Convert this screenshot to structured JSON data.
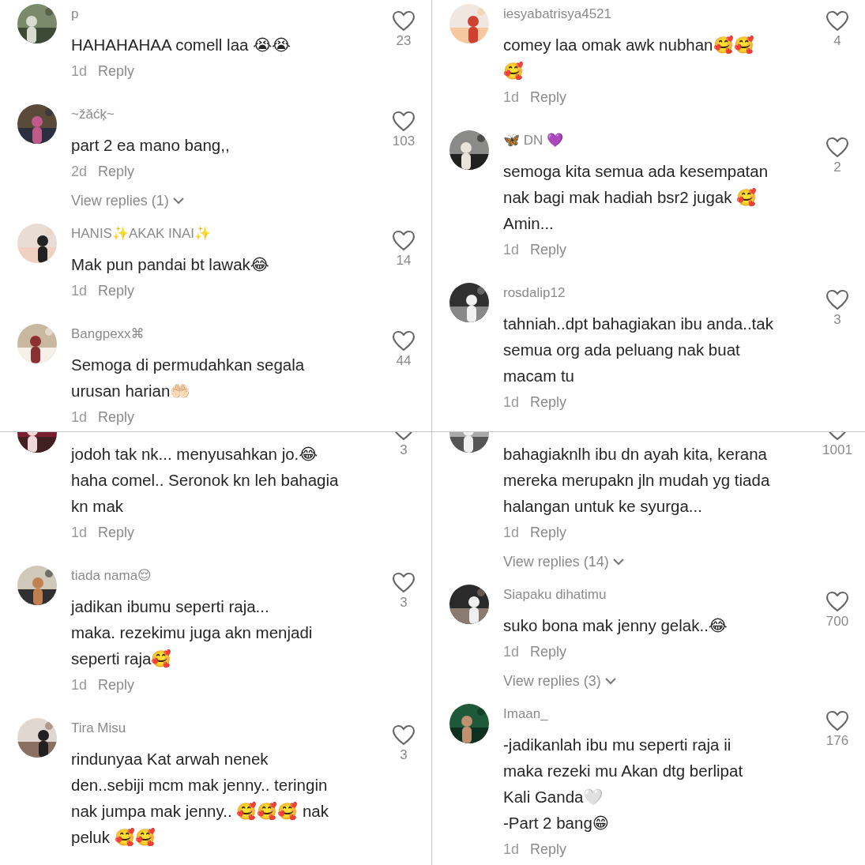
{
  "panels": [
    {
      "scrolled": false,
      "comments": [
        {
          "username": "p",
          "text": [
            "HAHAHAHAA comell laa 😭😭"
          ],
          "likes": "23",
          "age": "1d",
          "reply": "Reply"
        },
        {
          "username": "~žăćķ~",
          "text": [
            "part 2 ea mano bang,,"
          ],
          "likes": "103",
          "age": "2d",
          "reply": "Reply",
          "view_replies": "View replies (1)"
        },
        {
          "username": "HANIS✨AKAK INAI✨",
          "text": [
            "Mak pun pandai bt lawak😂"
          ],
          "likes": "14",
          "age": "1d",
          "reply": "Reply"
        },
        {
          "username": "Bangpexx⌘",
          "text": [
            "Semoga di permudahkan segala",
            "urusan harian🤲🏻"
          ],
          "likes": "44",
          "age": "1d",
          "reply": "Reply"
        }
      ]
    },
    {
      "scrolled": false,
      "comments": [
        {
          "username": "iesyabatrisya4521",
          "text": [
            "comey laa omak awk nubhan🥰🥰",
            "🥰"
          ],
          "likes": "4",
          "age": "1d",
          "reply": "Reply"
        },
        {
          "username": "🦋 DN 💜",
          "text": [
            "semoga kita semua ada kesempatan",
            "nak bagi mak hadiah bsr2 jugak 🥰",
            "Amin..."
          ],
          "likes": "2",
          "age": "1d",
          "reply": "Reply"
        },
        {
          "username": "rosdalip12",
          "text": [
            "tahniah..dpt bahagiakan ibu anda..tak",
            "semua org ada peluang nak buat",
            "macam tu"
          ],
          "likes": "3",
          "age": "1d",
          "reply": "Reply"
        }
      ]
    },
    {
      "scrolled": true,
      "comments": [
        {
          "text": [
            "jodoh tak nk... menyusahkan jo.😂",
            "haha comel.. Seronok kn leh bahagia",
            "kn mak"
          ],
          "likes": "3",
          "age": "1d",
          "reply": "Reply"
        },
        {
          "username": "tiada nama😌",
          "text": [
            "jadikan ibumu seperti raja...",
            "maka. rezekimu juga akn menjadi",
            "seperti raja🥰"
          ],
          "likes": "3",
          "age": "1d",
          "reply": "Reply"
        },
        {
          "username": "Tira Misu",
          "text": [
            "rindunyaa Kat arwah nenek",
            "den..sebiji mcm mak jenny.. teringin",
            "nak jumpa mak jenny.. 🥰🥰🥰 nak",
            "peluk 🥰🥰"
          ],
          "likes": "3"
        }
      ]
    },
    {
      "scrolled": true,
      "comments": [
        {
          "text": [
            "bahagiaknlh ibu dn ayah kita, kerana",
            "mereka merupakn jln mudah yg tiada",
            "halangan untuk ke syurga..."
          ],
          "likes": "1001",
          "age": "1d",
          "reply": "Reply",
          "view_replies": "View replies (14)"
        },
        {
          "username": "Siapaku dihatimu",
          "text": [
            "suko bona mak jenny gelak..😂"
          ],
          "likes": "700",
          "age": "1d",
          "reply": "Reply",
          "view_replies": "View replies (3)"
        },
        {
          "username": "Imaan_",
          "text": [
            "-jadikanlah ibu mu seperti raja ii",
            "maka rezeki mu Akan dtg berlipat",
            "Kali Ganda🤍",
            "-Part 2 bang😁"
          ],
          "likes": "176",
          "age": "1d",
          "reply": "Reply"
        }
      ]
    }
  ]
}
